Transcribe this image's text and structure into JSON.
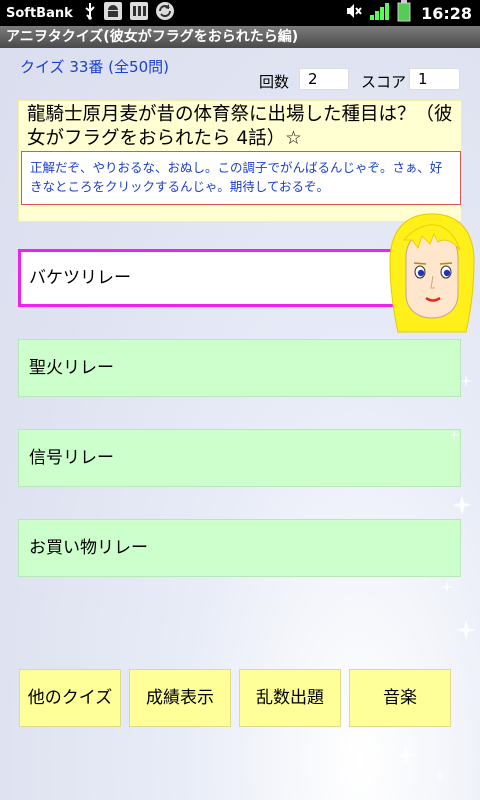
{
  "status_bar": {
    "carrier": "SoftBank",
    "time": "16:28",
    "icons": [
      "usb-icon",
      "android-debug-icon",
      "storage-icon",
      "sync-icon",
      "mute-icon",
      "signal-icon",
      "battery-icon"
    ]
  },
  "app": {
    "title": "アニヲタクイズ(彼女がフラグをおられたら編)"
  },
  "quiz": {
    "number_label": "クイズ 33番 (全50問)",
    "count_label": "回数",
    "count_value": "2",
    "score_label": "スコア",
    "score_value": "1",
    "question": "龍騎士原月麦が昔の体育祭に出場した種目は？（彼女がフラグをおられたら 4話）☆",
    "comment": "正解だぞ、やりおるな、おぬし。この調子でがんばるんじゃぞ。さぁ、好きなところをクリックするんじゃ。期待しておるぞ。"
  },
  "choices": [
    {
      "label": "バケツリレー",
      "selected": true
    },
    {
      "label": "聖火リレー",
      "selected": false
    },
    {
      "label": "信号リレー",
      "selected": false
    },
    {
      "label": "お買い物リレー",
      "selected": false
    }
  ],
  "bottom_buttons": {
    "other_quiz": "他のクイズ",
    "show_results": "成績表示",
    "random": "乱数出題",
    "music": "音楽"
  },
  "colors": {
    "choice_bg": "#ccffcc",
    "selected_border": "#ee22ee",
    "question_bg": "#ffffd2",
    "button_bg": "#ffff99",
    "accent_blue": "#1b3fd0"
  }
}
